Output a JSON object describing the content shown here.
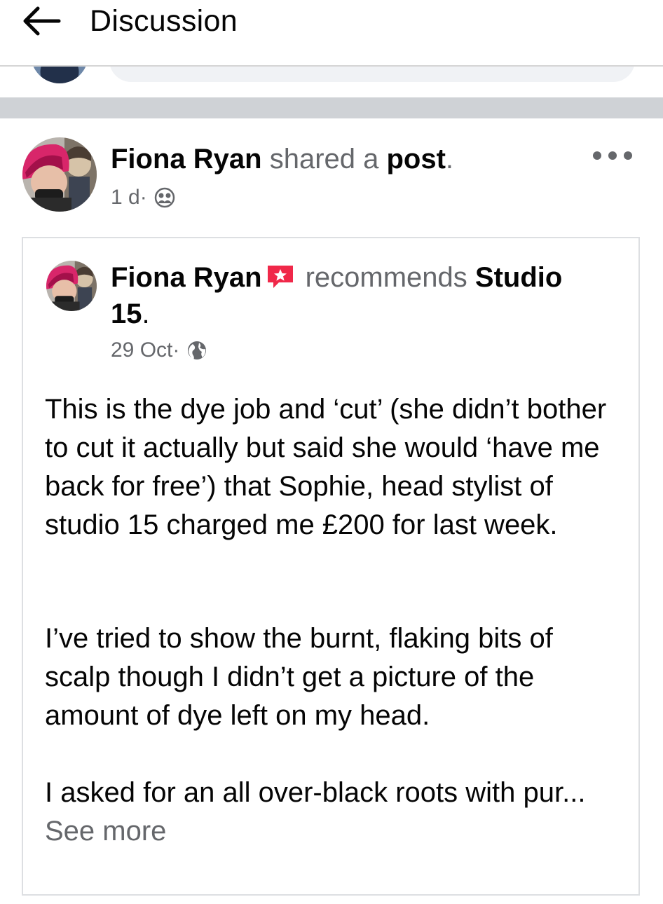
{
  "header": {
    "title": "Discussion"
  },
  "shared_post": {
    "author": "Fiona Ryan",
    "action_text": " shared a ",
    "object": "post",
    "period": ".",
    "time": "1 d",
    "separator": " · ",
    "audience_icon": "friends-icon"
  },
  "recommendation": {
    "author": "Fiona Ryan",
    "badge_icon": "recommendation-icon",
    "verb": "recommends",
    "target": "Studio 15",
    "period": ".",
    "date": "29 Oct",
    "separator": " · ",
    "audience_icon": "globe-icon",
    "paragraphs": [
      "This is the dye job and ‘cut’ (she didn’t bother to cut it actually but said she would ‘have me back for free’) that Sophie, head stylist of studio 15 charged me £200 for last week.",
      "I’ve tried to show the burnt, flaking bits of scalp though I didn’t get a picture of the amount of dye left on my head.",
      "I asked for an all over-black roots with pur..."
    ],
    "see_more": "See more"
  },
  "colors": {
    "primary_text": "#050505",
    "secondary_text": "#65676b",
    "divider": "#cfd2d6",
    "recommend_badge": "#f02849"
  }
}
